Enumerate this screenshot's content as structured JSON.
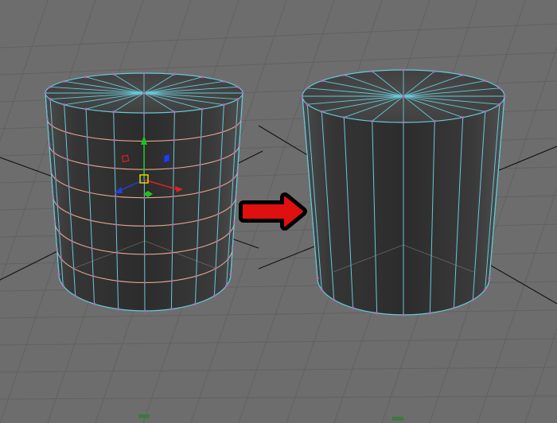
{
  "scene": {
    "background": "#6d6d6d",
    "grid_color": "#5f5f5f",
    "axis_line_color": "#111111",
    "edge_color": "#66c9d9",
    "vertex_color": "#b46ab4",
    "selected_loop_color": "#e0a890",
    "arrow_fill": "#e01010",
    "arrow_outline": "#000000"
  },
  "panels": [
    {
      "name": "before",
      "edge_loops": 6,
      "manipulator": true
    },
    {
      "name": "after",
      "edge_loops": 0,
      "manipulator": false
    }
  ],
  "manipulator": {
    "x_axis_color": "#e02020",
    "y_axis_color": "#20c020",
    "z_axis_color": "#2040e0",
    "center_color": "#e8d000"
  },
  "transition_arrow": {
    "icon": "right-arrow-icon",
    "direction": "right"
  }
}
